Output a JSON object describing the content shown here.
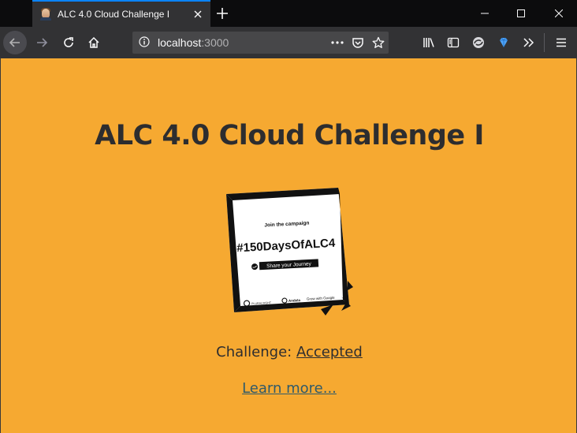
{
  "browser": {
    "tab_title": "ALC 4.0 Cloud Challenge I",
    "url_host": "localhost",
    "url_port": ":3000"
  },
  "page": {
    "heading": "ALC 4.0 Cloud Challenge I",
    "challenge_label": "Challenge: ",
    "challenge_link": "Accepted",
    "learn_more": "Learn more..."
  },
  "poster": {
    "join_text": "Join the campaign",
    "hashtag": "#150DaysOfALC4",
    "share_text": "Share your Journey",
    "logo_pluralsight": "PLURALSIGHT",
    "logo_andela": "Andela",
    "logo_google": "Grow with Google"
  },
  "colors": {
    "page_background": "#f6a931",
    "tab_accent": "#0a84ff",
    "chrome_dark": "#323234"
  },
  "icons": [
    "tab-favicon",
    "tab-close-icon",
    "new-tab-icon",
    "minimize-icon",
    "maximize-icon",
    "window-close-icon",
    "back-arrow-icon",
    "forward-arrow-icon",
    "reload-icon",
    "home-icon",
    "info-icon",
    "page-actions-icon",
    "pocket-icon",
    "bookmark-star-icon",
    "library-icon",
    "sidebar-icon",
    "sync-icon",
    "extension-gem-icon",
    "overflow-chevron-icon",
    "hamburger-menu-icon"
  ]
}
